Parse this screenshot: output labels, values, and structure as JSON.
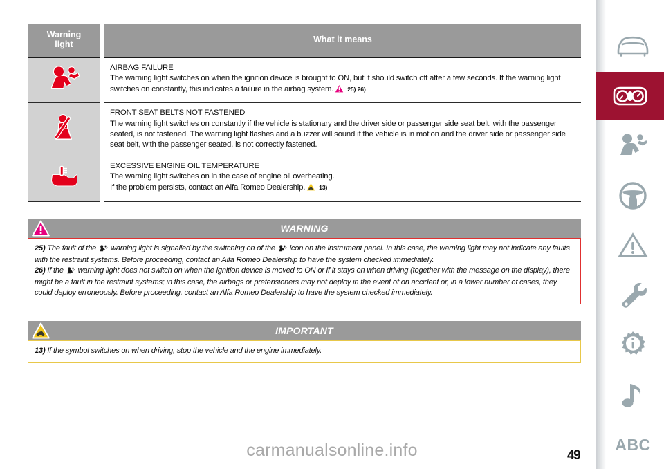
{
  "table": {
    "headers": {
      "warning_light": "Warning\nlight",
      "warning_light_line1": "Warning",
      "warning_light_line2": "light",
      "what_it_means": "What it means"
    },
    "rows": [
      {
        "icon": "airbag-failure-icon",
        "title": "AIRBAG FAILURE",
        "body": "The warning light switches on when the ignition device is brought to ON, but it should switch off after a few seconds. If the warning light switches on constantly, this indicates a failure in the airbag system.",
        "ref_symbol": "warning-triangle-pink-icon",
        "refs": "25) 26)"
      },
      {
        "icon": "seatbelt-not-fastened-icon",
        "title": "FRONT SEAT BELTS NOT FASTENED",
        "body": "The warning light switches on constantly if the vehicle is stationary and the driver side or passenger side seat belt, with the passenger seated, is not fastened. The warning light flashes and a buzzer will sound if the vehicle is in motion and the driver side or passenger side seat belt, with the passenger seated, is not correctly fastened.",
        "ref_symbol": "",
        "refs": ""
      },
      {
        "icon": "engine-oil-temperature-icon",
        "title": "EXCESSIVE ENGINE OIL TEMPERATURE",
        "body_line1": "The warning light switches on in the case of engine oil overheating.",
        "body_line2": "If the problem persists, contact an Alfa Romeo Dealership.",
        "ref_symbol": "important-triangle-yellow-icon",
        "refs": "13)"
      }
    ]
  },
  "warning_callout": {
    "bar_label": "WARNING",
    "bar_icon": "warning-triangle-pink-icon",
    "notes": [
      {
        "number": "25)",
        "text_part1": "The fault of the",
        "text_part2": "warning light is signalled by the switching on of the",
        "text_part3": "icon on the instrument panel. In this case, the warning light may not indicate any faults with the restraint systems. Before proceeding, contact an Alfa Romeo Dealership to have the system checked immediately."
      },
      {
        "number": "26)",
        "text_part1": "If the",
        "text_part2": "warning light does not switch on when the ignition device is moved to ON or if it stays on when driving (together with the message on the display), there might be a fault in the restraint systems; in this case, the airbags or pretensioners may not deploy in the event of on accident or, in a lower number of cases, they could deploy erroneously. Before proceeding, contact an Alfa Romeo Dealership to have the system checked immediately."
      }
    ]
  },
  "important_callout": {
    "bar_label": "IMPORTANT",
    "bar_icon": "important-triangle-yellow-icon",
    "notes": [
      {
        "number": "13)",
        "text": "If the symbol switches on when driving, stop the vehicle and the engine immediately."
      }
    ]
  },
  "sidebar": {
    "items": [
      {
        "icon": "car-front-icon",
        "active": false
      },
      {
        "icon": "instrument-cluster-icon",
        "active": true
      },
      {
        "icon": "airbag-safety-icon",
        "active": false
      },
      {
        "icon": "steering-wheel-icon",
        "active": false
      },
      {
        "icon": "warning-triangle-icon",
        "active": false
      },
      {
        "icon": "wrench-icon",
        "active": false
      },
      {
        "icon": "info-gear-icon",
        "active": false
      },
      {
        "icon": "music-note-icon",
        "active": false
      },
      {
        "icon": "abc-index-icon",
        "label": "ABC",
        "active": false
      }
    ],
    "active_color": "#9d1231",
    "icon_color": "#9aa8ae"
  },
  "footer": {
    "watermark": "carmanualsonline.info",
    "page_number": "49"
  },
  "colors": {
    "header_gray": "#9a9a9a",
    "cell_gray": "#d2d2d2",
    "warning_red": "#e3001b",
    "accent_crimson": "#9d1231",
    "pink_triangle": "#e6007e",
    "yellow_triangle": "#f0c419"
  }
}
